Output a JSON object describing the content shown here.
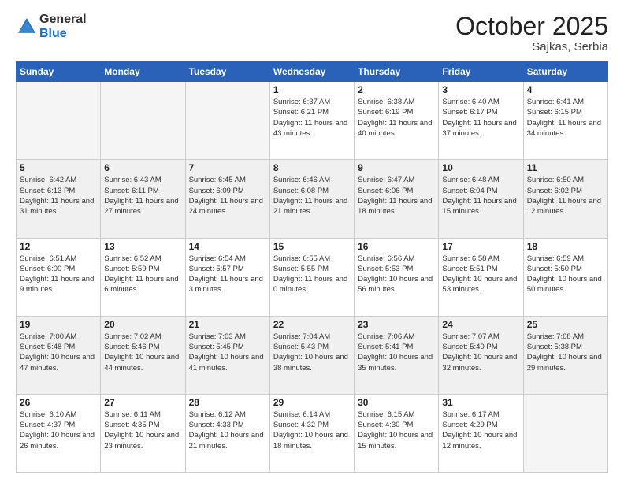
{
  "logo": {
    "general": "General",
    "blue": "Blue"
  },
  "header": {
    "month": "October 2025",
    "location": "Sajkas, Serbia"
  },
  "weekdays": [
    "Sunday",
    "Monday",
    "Tuesday",
    "Wednesday",
    "Thursday",
    "Friday",
    "Saturday"
  ],
  "days": [
    {
      "date": "",
      "empty": true
    },
    {
      "date": "",
      "empty": true
    },
    {
      "date": "",
      "empty": true
    },
    {
      "date": "1",
      "sunrise": "6:37 AM",
      "sunset": "6:21 PM",
      "daylight": "11 hours and 43 minutes."
    },
    {
      "date": "2",
      "sunrise": "6:38 AM",
      "sunset": "6:19 PM",
      "daylight": "11 hours and 40 minutes."
    },
    {
      "date": "3",
      "sunrise": "6:40 AM",
      "sunset": "6:17 PM",
      "daylight": "11 hours and 37 minutes."
    },
    {
      "date": "4",
      "sunrise": "6:41 AM",
      "sunset": "6:15 PM",
      "daylight": "11 hours and 34 minutes."
    },
    {
      "date": "5",
      "sunrise": "6:42 AM",
      "sunset": "6:13 PM",
      "daylight": "11 hours and 31 minutes."
    },
    {
      "date": "6",
      "sunrise": "6:43 AM",
      "sunset": "6:11 PM",
      "daylight": "11 hours and 27 minutes."
    },
    {
      "date": "7",
      "sunrise": "6:45 AM",
      "sunset": "6:09 PM",
      "daylight": "11 hours and 24 minutes."
    },
    {
      "date": "8",
      "sunrise": "6:46 AM",
      "sunset": "6:08 PM",
      "daylight": "11 hours and 21 minutes."
    },
    {
      "date": "9",
      "sunrise": "6:47 AM",
      "sunset": "6:06 PM",
      "daylight": "11 hours and 18 minutes."
    },
    {
      "date": "10",
      "sunrise": "6:48 AM",
      "sunset": "6:04 PM",
      "daylight": "11 hours and 15 minutes."
    },
    {
      "date": "11",
      "sunrise": "6:50 AM",
      "sunset": "6:02 PM",
      "daylight": "11 hours and 12 minutes."
    },
    {
      "date": "12",
      "sunrise": "6:51 AM",
      "sunset": "6:00 PM",
      "daylight": "11 hours and 9 minutes."
    },
    {
      "date": "13",
      "sunrise": "6:52 AM",
      "sunset": "5:59 PM",
      "daylight": "11 hours and 6 minutes."
    },
    {
      "date": "14",
      "sunrise": "6:54 AM",
      "sunset": "5:57 PM",
      "daylight": "11 hours and 3 minutes."
    },
    {
      "date": "15",
      "sunrise": "6:55 AM",
      "sunset": "5:55 PM",
      "daylight": "11 hours and 0 minutes."
    },
    {
      "date": "16",
      "sunrise": "6:56 AM",
      "sunset": "5:53 PM",
      "daylight": "10 hours and 56 minutes."
    },
    {
      "date": "17",
      "sunrise": "6:58 AM",
      "sunset": "5:51 PM",
      "daylight": "10 hours and 53 minutes."
    },
    {
      "date": "18",
      "sunrise": "6:59 AM",
      "sunset": "5:50 PM",
      "daylight": "10 hours and 50 minutes."
    },
    {
      "date": "19",
      "sunrise": "7:00 AM",
      "sunset": "5:48 PM",
      "daylight": "10 hours and 47 minutes."
    },
    {
      "date": "20",
      "sunrise": "7:02 AM",
      "sunset": "5:46 PM",
      "daylight": "10 hours and 44 minutes."
    },
    {
      "date": "21",
      "sunrise": "7:03 AM",
      "sunset": "5:45 PM",
      "daylight": "10 hours and 41 minutes."
    },
    {
      "date": "22",
      "sunrise": "7:04 AM",
      "sunset": "5:43 PM",
      "daylight": "10 hours and 38 minutes."
    },
    {
      "date": "23",
      "sunrise": "7:06 AM",
      "sunset": "5:41 PM",
      "daylight": "10 hours and 35 minutes."
    },
    {
      "date": "24",
      "sunrise": "7:07 AM",
      "sunset": "5:40 PM",
      "daylight": "10 hours and 32 minutes."
    },
    {
      "date": "25",
      "sunrise": "7:08 AM",
      "sunset": "5:38 PM",
      "daylight": "10 hours and 29 minutes."
    },
    {
      "date": "26",
      "sunrise": "6:10 AM",
      "sunset": "4:37 PM",
      "daylight": "10 hours and 26 minutes."
    },
    {
      "date": "27",
      "sunrise": "6:11 AM",
      "sunset": "4:35 PM",
      "daylight": "10 hours and 23 minutes."
    },
    {
      "date": "28",
      "sunrise": "6:12 AM",
      "sunset": "4:33 PM",
      "daylight": "10 hours and 21 minutes."
    },
    {
      "date": "29",
      "sunrise": "6:14 AM",
      "sunset": "4:32 PM",
      "daylight": "10 hours and 18 minutes."
    },
    {
      "date": "30",
      "sunrise": "6:15 AM",
      "sunset": "4:30 PM",
      "daylight": "10 hours and 15 minutes."
    },
    {
      "date": "31",
      "sunrise": "6:17 AM",
      "sunset": "4:29 PM",
      "daylight": "10 hours and 12 minutes."
    },
    {
      "date": "",
      "empty": true
    }
  ],
  "labels": {
    "sunrise": "Sunrise:",
    "sunset": "Sunset:",
    "daylight": "Daylight:"
  }
}
